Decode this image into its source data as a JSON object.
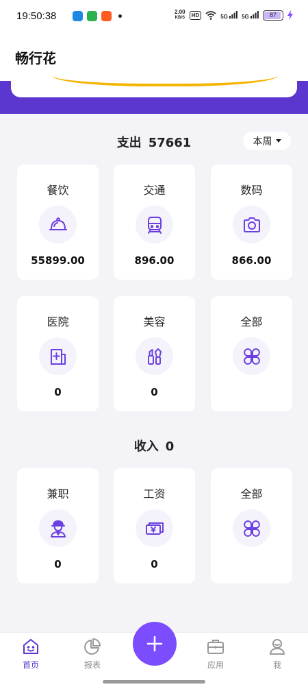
{
  "status_bar": {
    "time": "19:50:38",
    "net_speed_value": "2.00",
    "net_speed_unit": "KB/S",
    "hd": "HD",
    "sig1": "5G",
    "sig2": "5G",
    "battery": "87"
  },
  "app": {
    "title": "畅行花"
  },
  "expense": {
    "label": "支出",
    "total": "57661",
    "period": "本周",
    "categories": [
      {
        "label": "餐饮",
        "icon": "cloche-icon",
        "value": "55899.00"
      },
      {
        "label": "交通",
        "icon": "train-icon",
        "value": "896.00"
      },
      {
        "label": "数码",
        "icon": "camera-icon",
        "value": "866.00"
      },
      {
        "label": "医院",
        "icon": "hospital-icon",
        "value": "0"
      },
      {
        "label": "美容",
        "icon": "cosmetics-icon",
        "value": "0"
      },
      {
        "label": "全部",
        "icon": "all-grid-icon",
        "value": ""
      }
    ]
  },
  "income": {
    "label": "收入",
    "total": "0",
    "categories": [
      {
        "label": "兼职",
        "icon": "worker-icon",
        "value": "0"
      },
      {
        "label": "工资",
        "icon": "salary-icon",
        "value": "0"
      },
      {
        "label": "全部",
        "icon": "all-grid-icon",
        "value": ""
      }
    ]
  },
  "nav": {
    "home": "首页",
    "report": "报表",
    "apps": "应用",
    "me": "我"
  },
  "colors": {
    "accent": "#5b36cf",
    "fab": "#7c4dff",
    "icon": "#6b3fe0"
  }
}
